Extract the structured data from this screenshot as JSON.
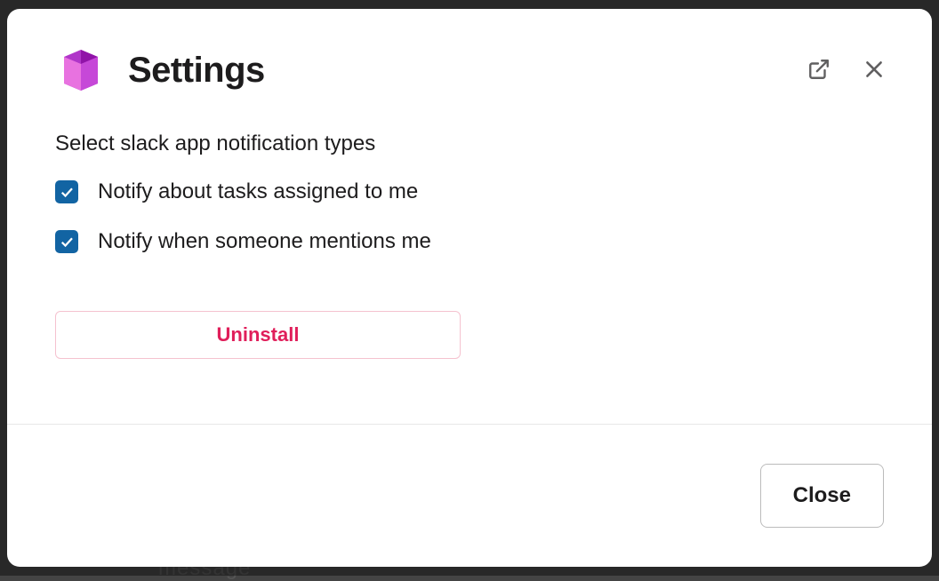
{
  "header": {
    "title": "Settings"
  },
  "body": {
    "section_label": "Select slack app notification types",
    "options": [
      {
        "label": "Notify about tasks assigned to me",
        "checked": true
      },
      {
        "label": "Notify when someone mentions me",
        "checked": true
      }
    ],
    "uninstall_label": "Uninstall"
  },
  "footer": {
    "close_label": "Close"
  },
  "colors": {
    "checkbox_checked": "#1264a3",
    "danger": "#e01e5a"
  },
  "background_fragment": "message"
}
